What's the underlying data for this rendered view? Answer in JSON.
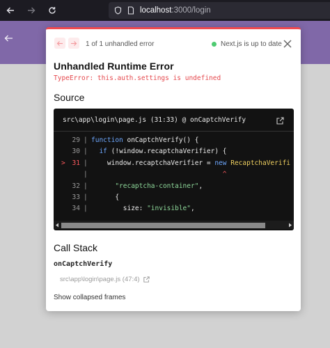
{
  "browser": {
    "url_host": "localhost",
    "url_path": ":3000/login"
  },
  "overlay": {
    "pager_count": "1 of 1 unhandled error",
    "status_text": "Next.js is up to date",
    "title": "Unhandled Runtime Error",
    "error_message": "TypeError: this.auth.settings is undefined",
    "source_heading": "Source",
    "code_frame": {
      "file": "src\\app\\login\\page.js (31:33) @ onCaptchVerify",
      "lines": [
        {
          "no": "29",
          "marker": "",
          "code": "function onCaptchVerify() {"
        },
        {
          "no": "30",
          "marker": "",
          "code": "  if (!window.recaptchaVerifier) {"
        },
        {
          "no": "31",
          "marker": ">",
          "code": "    window.recaptchaVerifier = new RecaptchaVerifi"
        },
        {
          "no": "",
          "marker": "",
          "code": "                                 ^"
        },
        {
          "no": "32",
          "marker": "",
          "code": "      \"recaptcha-container\","
        },
        {
          "no": "33",
          "marker": "",
          "code": "      {"
        },
        {
          "no": "34",
          "marker": "",
          "code": "        size: \"invisible\","
        }
      ]
    },
    "call_stack_heading": "Call Stack",
    "frame_function": "onCaptchVerify",
    "frame_location": "src\\app\\login\\page.js (47:4)",
    "show_collapsed": "Show collapsed frames"
  },
  "colors": {
    "accent_red": "#f04a50",
    "status_green": "#4ecb71",
    "page_purple": "#8068a8"
  },
  "icons": [
    "back-arrow-icon",
    "forward-arrow-icon",
    "reload-icon",
    "shield-icon",
    "page-icon",
    "prev-error-icon",
    "next-error-icon",
    "close-icon",
    "external-link-icon"
  ]
}
